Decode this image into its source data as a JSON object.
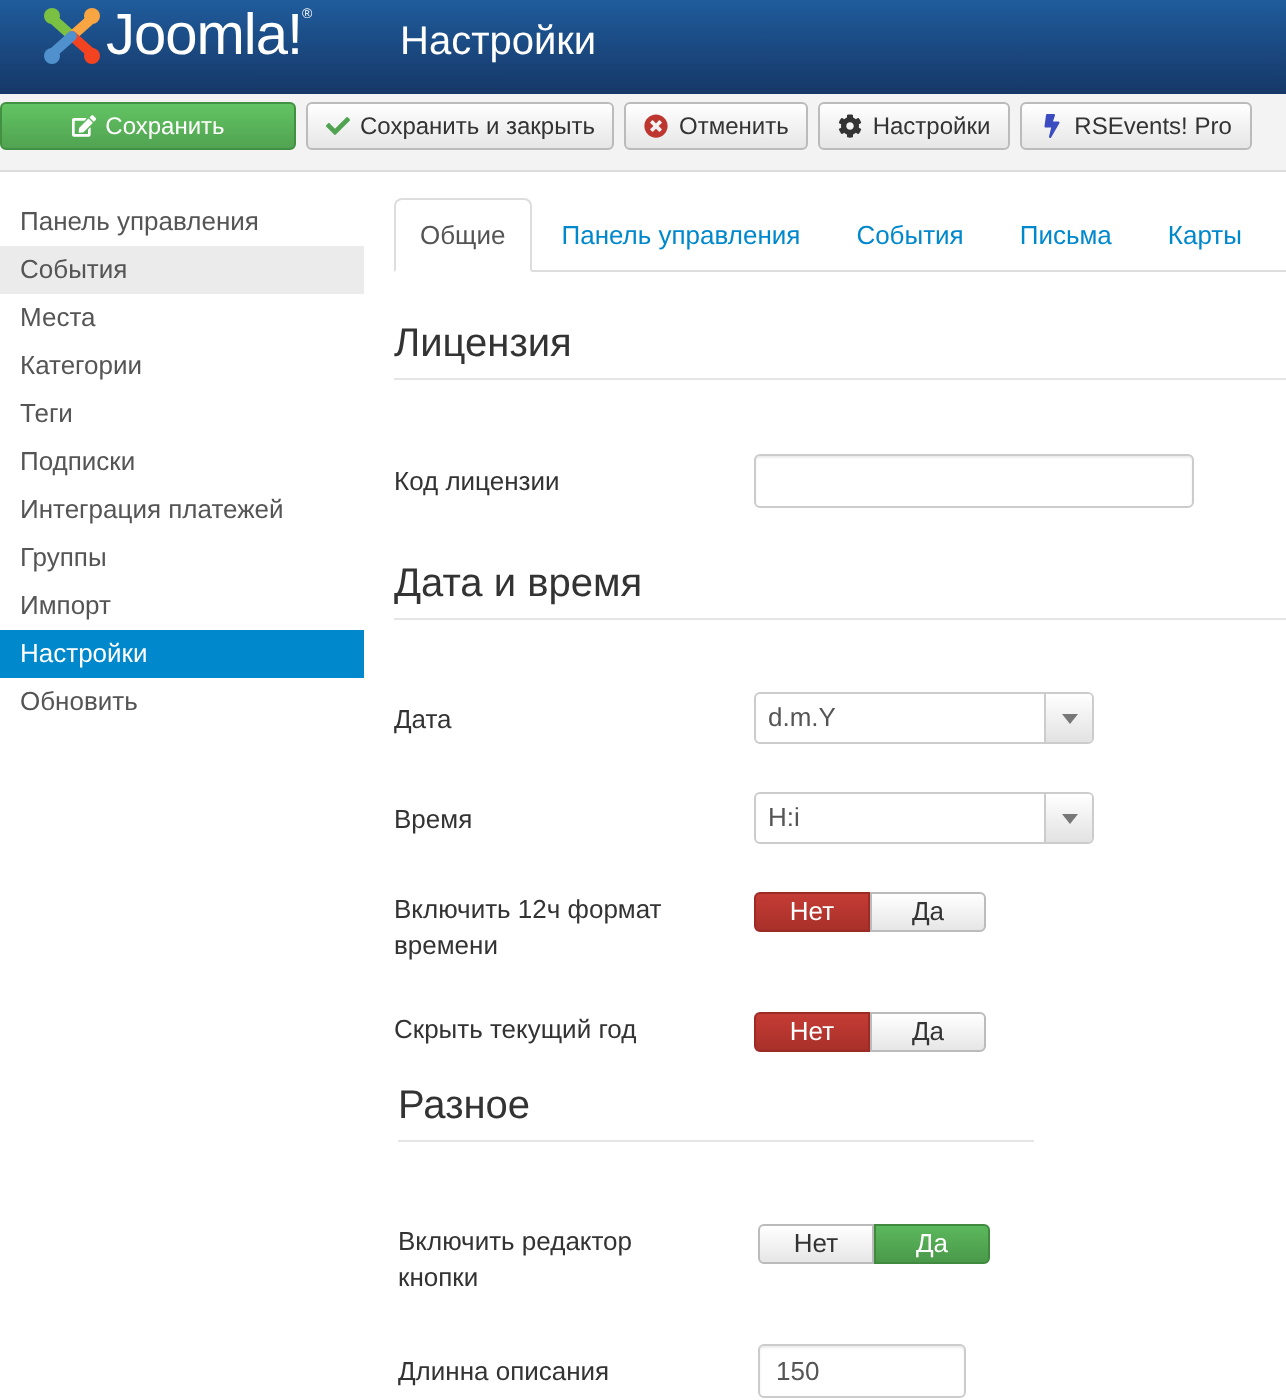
{
  "header": {
    "logo": {
      "text": "Joomla!",
      "mark": "®"
    },
    "title": "Настройки"
  },
  "toolbar": {
    "buttons": [
      {
        "label": "Сохранить",
        "kind": "primary"
      },
      {
        "label": "Сохранить и закрыть",
        "kind": "default"
      },
      {
        "label": "Отменить",
        "kind": "default"
      },
      {
        "label": "Настройки",
        "kind": "default"
      },
      {
        "label": "RSEvents! Pro",
        "kind": "default"
      }
    ]
  },
  "sidebar": {
    "items": [
      {
        "label": "Панель управления",
        "selected": false,
        "hovered": false
      },
      {
        "label": "События",
        "selected": false,
        "hovered": true
      },
      {
        "label": "Места",
        "selected": false,
        "hovered": false
      },
      {
        "label": "Категории",
        "selected": false,
        "hovered": false
      },
      {
        "label": "Теги",
        "selected": false,
        "hovered": false
      },
      {
        "label": "Подписки",
        "selected": false,
        "hovered": false
      },
      {
        "label": "Интеграция платежей",
        "selected": false,
        "hovered": false
      },
      {
        "label": "Группы",
        "selected": false,
        "hovered": false
      },
      {
        "label": "Импорт",
        "selected": false,
        "hovered": false
      },
      {
        "label": "Настройки",
        "selected": true,
        "hovered": false
      },
      {
        "label": "Обновить",
        "selected": false,
        "hovered": false
      }
    ]
  },
  "tabs": [
    {
      "label": "Общие",
      "selected": true
    },
    {
      "label": "Панель управления",
      "selected": false
    },
    {
      "label": "События",
      "selected": false
    },
    {
      "label": "Письма",
      "selected": false
    },
    {
      "label": "Карты",
      "selected": false
    }
  ],
  "sections": [
    {
      "heading": "Лицензия",
      "fields": [
        {
          "label": "Код лицензии",
          "kind": "text"
        }
      ]
    },
    {
      "heading": "Дата и время",
      "fields": [
        {
          "label": "Дата",
          "kind": "select",
          "value": "d.m.Y"
        },
        {
          "label": "Время",
          "kind": "select",
          "value": "H:i"
        },
        {
          "label": "Включить 12ч формат времени",
          "kind": "toggle",
          "options": [
            {
              "label": "Нет",
              "selected": true
            },
            {
              "label": "Да",
              "selected": false
            }
          ]
        },
        {
          "label": "Скрыть текущий год",
          "kind": "toggle",
          "options": [
            {
              "label": "Нет",
              "selected": true
            },
            {
              "label": "Да",
              "selected": false
            }
          ]
        }
      ]
    },
    {
      "heading": "Разное",
      "fields": [
        {
          "label": "Включить редактор кнопки",
          "kind": "toggle",
          "options": [
            {
              "label": "Нет",
              "selected": false
            },
            {
              "label": "Да",
              "selected": true
            }
          ]
        },
        {
          "label": "Длинна описания",
          "kind": "number",
          "value": "150"
        }
      ]
    }
  ]
}
